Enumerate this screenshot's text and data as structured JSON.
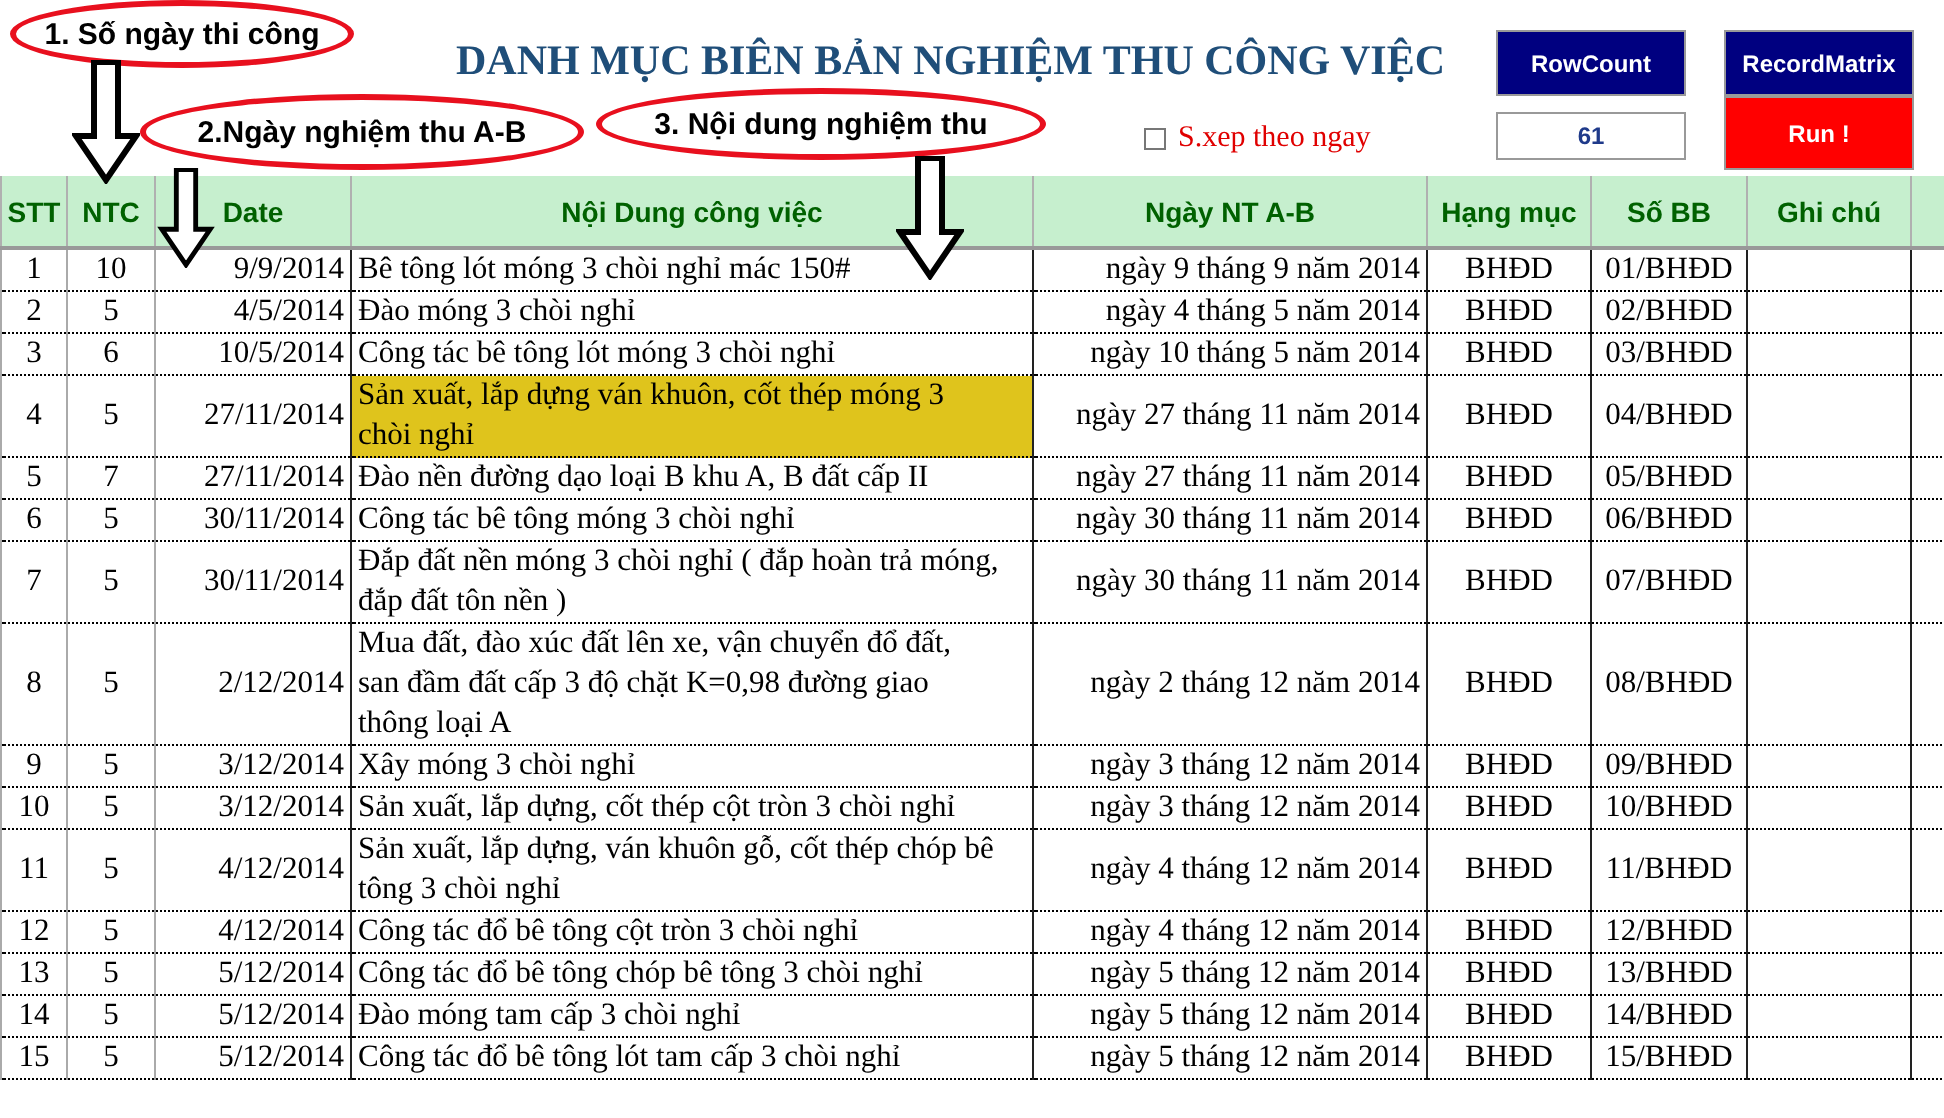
{
  "title": "DANH MỤC BIÊN BẢN NGHIỆM THU CÔNG VIỆC",
  "buttons": [
    {
      "label": "RowCount",
      "kind": "navy"
    },
    {
      "label": "RecordMatrix",
      "kind": "navy"
    },
    {
      "label": "Run !",
      "kind": "red"
    }
  ],
  "row_count_value": "61",
  "sort_checkbox": {
    "label": "S.xep theo ngay",
    "checked": false
  },
  "annotations": [
    {
      "label": "1. Số ngày thi công"
    },
    {
      "label": "2.Ngày nghiệm thu A-B"
    },
    {
      "label": "3. Nội dung nghiệm thu"
    }
  ],
  "table": {
    "columns": [
      "STT",
      "NTC",
      "Date",
      "Nội Dung công việc",
      "Ngày NT A-B",
      "Hạng mục",
      "Số BB",
      "Ghi chú"
    ],
    "rows": [
      {
        "cells": [
          "1",
          "10",
          "9/9/2014",
          "Bê tông lót móng 3 chòi nghỉ mác 150#",
          "ngày 9 tháng 9 năm 2014",
          "BHĐD",
          "01/BHĐD"
        ],
        "highlighted": false
      },
      {
        "cells": [
          "2",
          "5",
          "4/5/2014",
          "Đào móng 3 chòi nghỉ",
          "ngày 4 tháng 5 năm 2014",
          "BHĐD",
          "02/BHĐD"
        ],
        "highlighted": false
      },
      {
        "cells": [
          "3",
          "6",
          "10/5/2014",
          "Công tác bê tông lót móng 3 chòi nghỉ",
          "ngày 10 tháng 5 năm 2014",
          "BHĐD",
          "03/BHĐD"
        ],
        "highlighted": false
      },
      {
        "cells": [
          "4",
          "5",
          "27/11/2014",
          "Sản xuất, lắp dựng ván khuôn, cốt thép móng 3 chòi nghỉ",
          "ngày 27 tháng 11 năm 2014",
          "BHĐD",
          "04/BHĐD"
        ],
        "highlighted": true
      },
      {
        "cells": [
          "5",
          "7",
          "27/11/2014",
          "Đào nền đường dạo loại B khu A, B đất cấp II",
          "ngày 27 tháng 11 năm 2014",
          "BHĐD",
          "05/BHĐD"
        ],
        "highlighted": false
      },
      {
        "cells": [
          "6",
          "5",
          "30/11/2014",
          "Công tác bê tông móng 3 chòi nghỉ",
          "ngày 30 tháng 11 năm 2014",
          "BHĐD",
          "06/BHĐD"
        ],
        "highlighted": false
      },
      {
        "cells": [
          "7",
          "5",
          "30/11/2014",
          "Đắp đất nền móng 3 chòi nghỉ ( đắp hoàn trả móng, đắp đất tôn nền )",
          "ngày 30 tháng 11 năm 2014",
          "BHĐD",
          "07/BHĐD"
        ],
        "highlighted": false
      },
      {
        "cells": [
          "8",
          "5",
          "2/12/2014",
          "Mua đất, đào xúc đất lên xe, vận chuyển đổ đất, san đầm đất cấp 3 độ chặt K=0,98 đường giao thông loại A",
          "ngày 2 tháng 12 năm 2014",
          "BHĐD",
          "08/BHĐD"
        ],
        "highlighted": false
      },
      {
        "cells": [
          "9",
          "5",
          "3/12/2014",
          "Xây móng 3 chòi nghỉ",
          "ngày 3 tháng 12 năm 2014",
          "BHĐD",
          "09/BHĐD"
        ],
        "highlighted": false
      },
      {
        "cells": [
          "10",
          "5",
          "3/12/2014",
          "Sản xuất, lắp dựng, cốt thép cột tròn 3 chòi nghỉ",
          "ngày 3 tháng 12 năm 2014",
          "BHĐD",
          "10/BHĐD"
        ],
        "highlighted": false
      },
      {
        "cells": [
          "11",
          "5",
          "4/12/2014",
          "Sản xuất, lắp dựng, ván khuôn gỗ, cốt thép chóp bê tông 3 chòi nghỉ",
          "ngày 4 tháng 12 năm 2014",
          "BHĐD",
          "11/BHĐD"
        ],
        "highlighted": false
      },
      {
        "cells": [
          "12",
          "5",
          "4/12/2014",
          "Công tác đổ bê tông cột tròn 3 chòi nghỉ",
          "ngày 4 tháng 12 năm 2014",
          "BHĐD",
          "12/BHĐD"
        ],
        "highlighted": false
      },
      {
        "cells": [
          "13",
          "5",
          "5/12/2014",
          "Công tác đổ bê tông chóp bê tông 3 chòi nghỉ",
          "ngày 5 tháng 12 năm 2014",
          "BHĐD",
          "13/BHĐD"
        ],
        "highlighted": false
      },
      {
        "cells": [
          "14",
          "5",
          "5/12/2014",
          "Đào móng tam cấp 3 chòi nghỉ",
          "ngày 5 tháng 12 năm 2014",
          "BHĐD",
          "14/BHĐD"
        ],
        "highlighted": false
      },
      {
        "cells": [
          "15",
          "5",
          "5/12/2014",
          "Công tác đổ bê tông lót tam cấp 3 chòi nghỉ",
          "ngày 5 tháng 12 năm 2014",
          "BHĐD",
          "15/BHĐD"
        ],
        "highlighted": false
      }
    ]
  }
}
